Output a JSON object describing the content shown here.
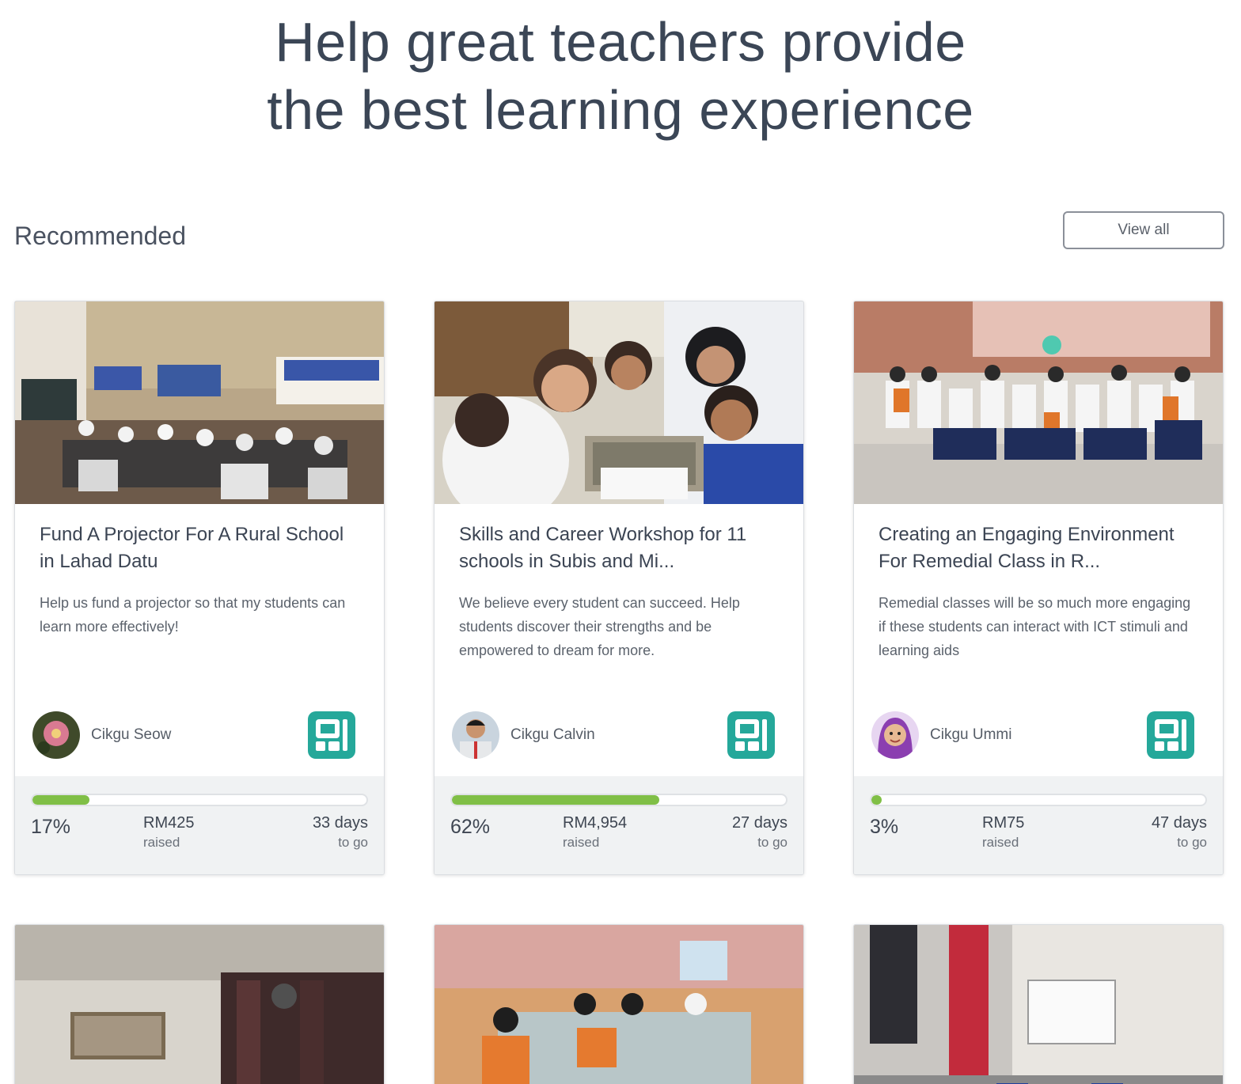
{
  "hero": {
    "line1": "Help great teachers provide",
    "line2": "the best learning experience"
  },
  "section": {
    "title": "Recommended",
    "view_all_label": "View all"
  },
  "colors": {
    "progress": "#80bf46",
    "badge": "#25a89a",
    "text": "#3b4453"
  },
  "projects": [
    {
      "title": "Fund A Projector For A Rural School in Lahad Datu",
      "description": "Help us fund a projector so that my students can learn more effectively!",
      "teacher": "Cikgu Seow",
      "avatar_icon": "flower-avatar",
      "badge_icon": "tutor-badge-icon",
      "percent_label": "17%",
      "progress": 0.17,
      "amount": "RM425",
      "amount_label": "raised",
      "days": "33 days",
      "days_label": "to go"
    },
    {
      "title": "Skills and Career Workshop for 11 schools in Subis and Mi...",
      "description": "We believe every student can succeed. Help students discover their strengths and be empowered to dream for more.",
      "teacher": "Cikgu Calvin",
      "avatar_icon": "teacher-avatar",
      "badge_icon": "tutor-badge-icon",
      "percent_label": "62%",
      "progress": 0.62,
      "amount": "RM4,954",
      "amount_label": "raised",
      "days": "27 days",
      "days_label": "to go"
    },
    {
      "title": "Creating an Engaging Environment For Remedial Class in R...",
      "description": "Remedial classes will be so much more engaging if these students can interact with ICT stimuli and learning aids",
      "teacher": "Cikgu Ummi",
      "avatar_icon": "teacher-avatar",
      "badge_icon": "tutor-badge-icon",
      "percent_label": "3%",
      "progress": 0.03,
      "amount": "RM75",
      "amount_label": "raised",
      "days": "47 days",
      "days_label": "to go"
    }
  ]
}
